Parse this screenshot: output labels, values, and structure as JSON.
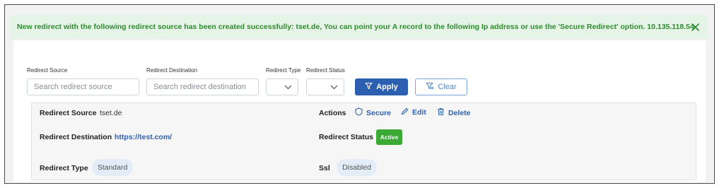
{
  "alert": {
    "message": "New redirect with the following redirect source has been created successfully: tset.de, You can point your A record to the following Ip address or use the 'Secure Redirect' option. 10.135.118.54",
    "close_icon": "close-icon",
    "color": "#2e8b2e"
  },
  "filters": {
    "source_label": "Redirect Source",
    "source_placeholder": "Search redirect source",
    "destination_label": "Redirect Destination",
    "destination_placeholder": "Search redirect destination",
    "type_label": "Redirect Type",
    "status_label": "Redirect Status",
    "apply_label": "Apply",
    "clear_label": "Clear",
    "filter_icon": "filter-icon",
    "clear_filter_icon": "filter-clear-icon"
  },
  "redirect": {
    "source_label": "Redirect Source",
    "source_value": "tset.de",
    "destination_label": "Redirect Destination",
    "destination_value": "https://test.com/",
    "type_label": "Redirect Type",
    "type_value": "Standard",
    "actions_label": "Actions",
    "status_label": "Redirect Status",
    "status_value": "Active",
    "ssl_label": "Ssl",
    "ssl_value": "Disabled",
    "actions": {
      "secure": "Secure",
      "edit": "Edit",
      "delete": "Delete"
    }
  },
  "colors": {
    "primary": "#2d5fb0",
    "success": "#3aaa35",
    "alert_bg": "#e6f4e8"
  }
}
